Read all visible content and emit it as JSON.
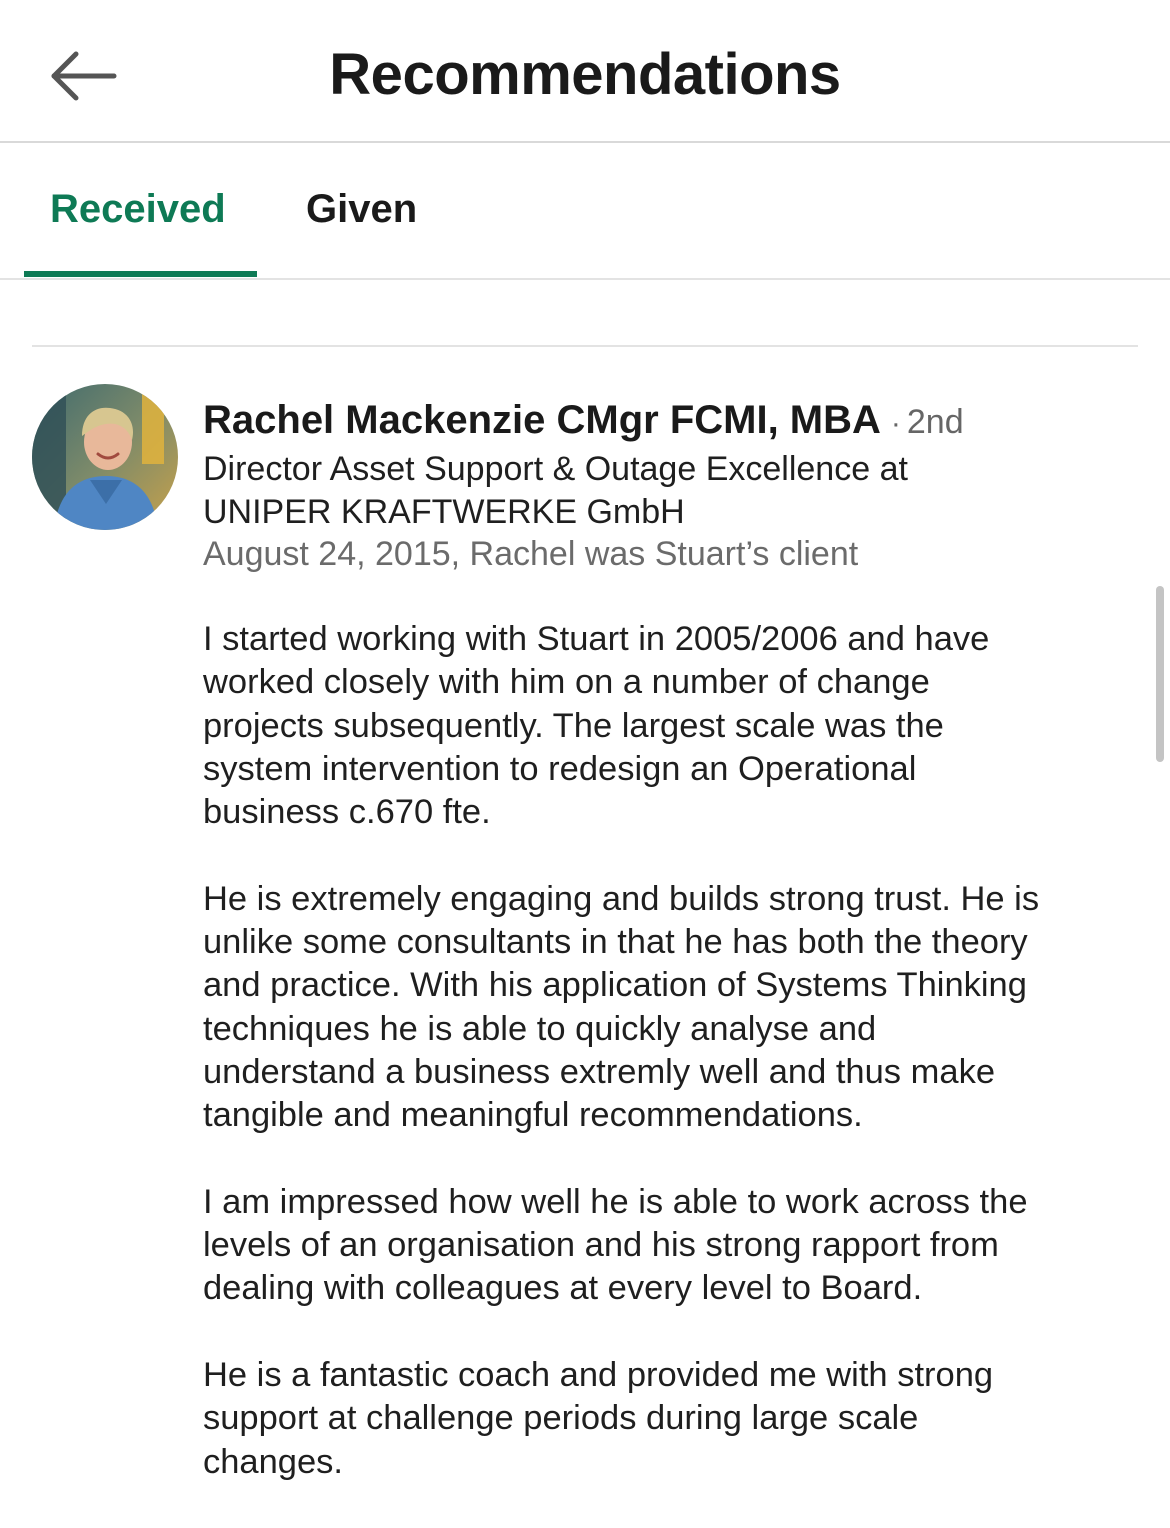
{
  "header": {
    "title": "Recommendations",
    "back_icon": "arrow-left-icon"
  },
  "tabs": [
    {
      "label": "Received",
      "active": true
    },
    {
      "label": "Given",
      "active": false
    }
  ],
  "colors": {
    "accent": "#0e7a55",
    "text_primary": "#1a1a1a",
    "text_secondary": "#6b6b6b",
    "divider": "#e3e3e3"
  },
  "recommendation": {
    "avatar_icon": "profile-photo",
    "name": "Rachel Mackenzie CMgr FCMI, MBA",
    "separator": "·",
    "degree": "2nd",
    "headline_lines": [
      "Director Asset Support & Outage Excellence at",
      "UNIPER KRAFTWERKE GmbH"
    ],
    "meta": "August 24, 2015, Rachel was Stuart’s client",
    "paragraphs": [
      [
        "I started working with Stuart in 2005/2006 and have",
        "worked closely with him on a number of change",
        "projects subsequently. The largest scale was the",
        "system intervention to redesign an Operational",
        "business c.670 fte."
      ],
      [
        "He is extremely engaging and builds strong trust. He is",
        "unlike some consultants in that he has both the theory",
        "and practice. With his application of Systems Thinking",
        "techniques he is able to quickly analyse and",
        "understand a business extremly well and thus make",
        "tangible and meaningful recommendations."
      ],
      [
        "I am impressed how well he is able to work across the",
        "levels of an organisation and his strong rapport from",
        "dealing with colleagues at every level to Board."
      ],
      [
        "He is a fantastic coach and provided me with strong",
        "support at challenge periods during large scale",
        "changes."
      ]
    ]
  }
}
